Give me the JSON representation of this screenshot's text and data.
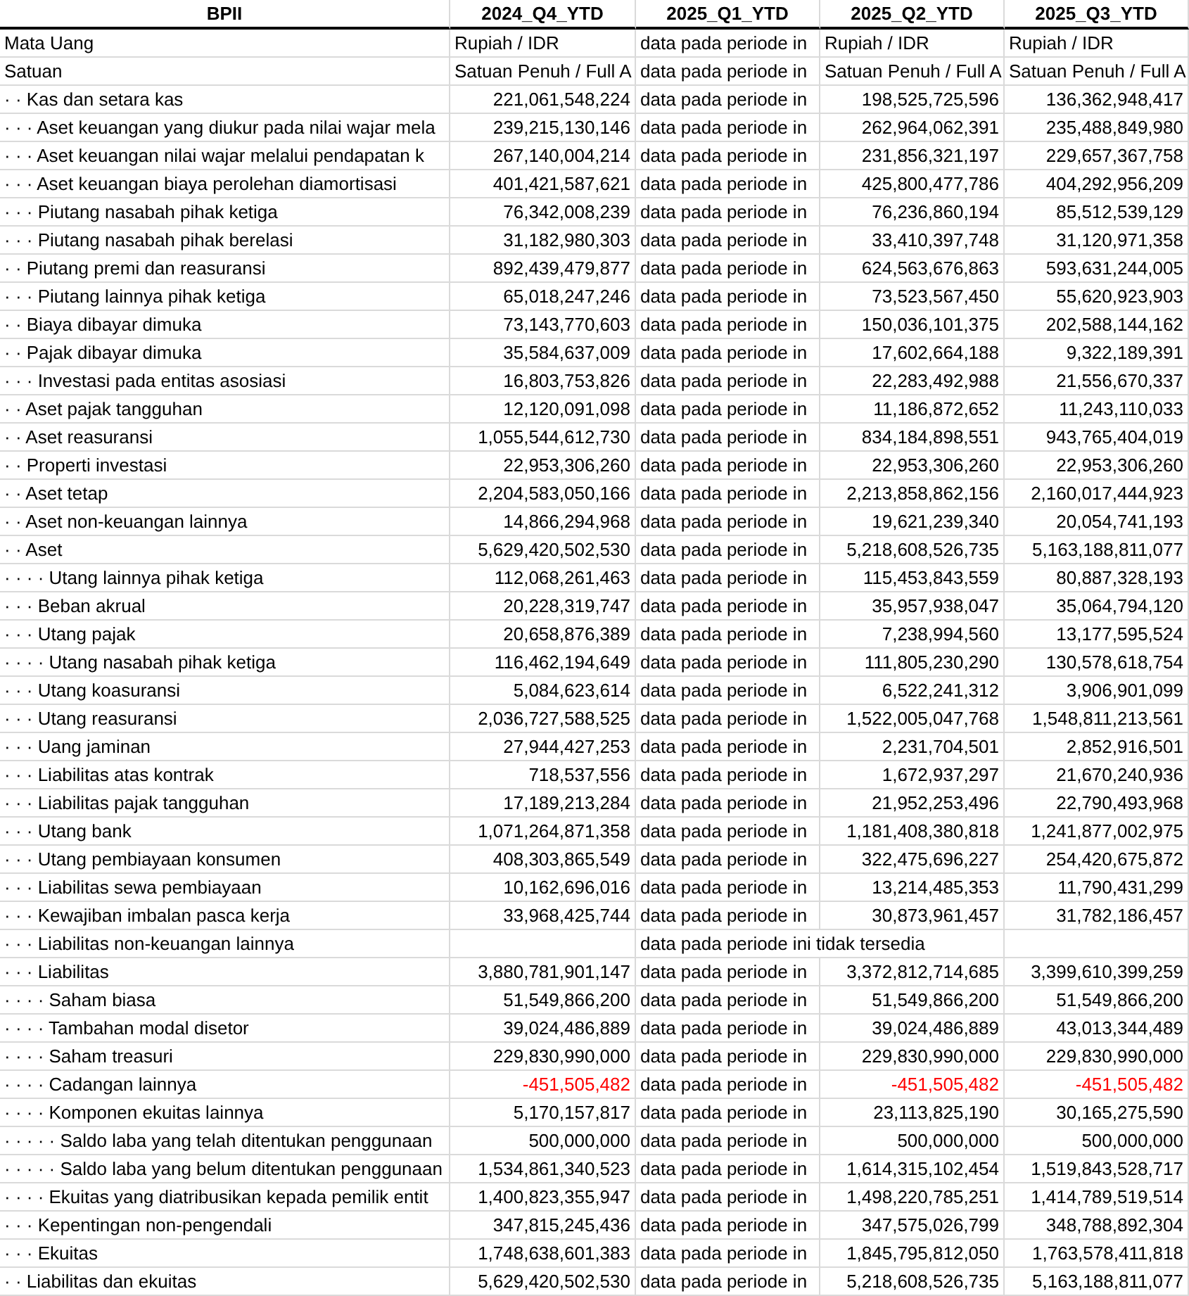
{
  "table": {
    "columns": [
      "BPII",
      "2024_Q4_YTD",
      "2025_Q1_YTD",
      "2025_Q2_YTD",
      "2025_Q3_YTD"
    ],
    "rows": [
      {
        "kind": "meta",
        "label": "Mata Uang",
        "values": [
          "Rupiah / IDR",
          "data pada periode in",
          "Rupiah / IDR",
          "Rupiah / IDR"
        ]
      },
      {
        "kind": "meta",
        "label": "Satuan",
        "values": [
          "Satuan Penuh / Full A",
          "data pada periode in",
          "Satuan Penuh / Full A",
          "Satuan Penuh / Full A"
        ]
      },
      {
        "kind": "data",
        "label": "· · Kas dan setara kas",
        "values": [
          "221,061,548,224",
          "data pada periode in",
          "198,525,725,596",
          "136,362,948,417"
        ]
      },
      {
        "kind": "data",
        "label": "· · · Aset keuangan yang diukur pada nilai wajar mela",
        "values": [
          "239,215,130,146",
          "data pada periode in",
          "262,964,062,391",
          "235,488,849,980"
        ]
      },
      {
        "kind": "data",
        "label": "· · · Aset keuangan nilai wajar melalui pendapatan k",
        "values": [
          "267,140,004,214",
          "data pada periode in",
          "231,856,321,197",
          "229,657,367,758"
        ]
      },
      {
        "kind": "data",
        "label": "· · · Aset keuangan biaya perolehan diamortisasi",
        "values": [
          "401,421,587,621",
          "data pada periode in",
          "425,800,477,786",
          "404,292,956,209"
        ]
      },
      {
        "kind": "data",
        "label": "· · · Piutang nasabah pihak ketiga",
        "values": [
          "76,342,008,239",
          "data pada periode in",
          "76,236,860,194",
          "85,512,539,129"
        ]
      },
      {
        "kind": "data",
        "label": "· · · Piutang nasabah pihak berelasi",
        "values": [
          "31,182,980,303",
          "data pada periode in",
          "33,410,397,748",
          "31,120,971,358"
        ]
      },
      {
        "kind": "data",
        "label": "· · Piutang premi dan reasuransi",
        "values": [
          "892,439,479,877",
          "data pada periode in",
          "624,563,676,863",
          "593,631,244,005"
        ]
      },
      {
        "kind": "data",
        "label": "· · · Piutang lainnya pihak ketiga",
        "values": [
          "65,018,247,246",
          "data pada periode in",
          "73,523,567,450",
          "55,620,923,903"
        ]
      },
      {
        "kind": "data",
        "label": "· · Biaya dibayar dimuka",
        "values": [
          "73,143,770,603",
          "data pada periode in",
          "150,036,101,375",
          "202,588,144,162"
        ]
      },
      {
        "kind": "data",
        "label": "· · Pajak dibayar dimuka",
        "values": [
          "35,584,637,009",
          "data pada periode in",
          "17,602,664,188",
          "9,322,189,391"
        ]
      },
      {
        "kind": "data",
        "label": "· · · Investasi pada entitas asosiasi",
        "values": [
          "16,803,753,826",
          "data pada periode in",
          "22,283,492,988",
          "21,556,670,337"
        ]
      },
      {
        "kind": "data",
        "label": "· · Aset pajak tangguhan",
        "values": [
          "12,120,091,098",
          "data pada periode in",
          "11,186,872,652",
          "11,243,110,033"
        ]
      },
      {
        "kind": "data",
        "label": "· · Aset reasuransi",
        "values": [
          "1,055,544,612,730",
          "data pada periode in",
          "834,184,898,551",
          "943,765,404,019"
        ]
      },
      {
        "kind": "data",
        "label": "· · Properti investasi",
        "values": [
          "22,953,306,260",
          "data pada periode in",
          "22,953,306,260",
          "22,953,306,260"
        ]
      },
      {
        "kind": "data",
        "label": "· · Aset tetap",
        "values": [
          "2,204,583,050,166",
          "data pada periode in",
          "2,213,858,862,156",
          "2,160,017,444,923"
        ]
      },
      {
        "kind": "data",
        "label": "· · Aset non-keuangan lainnya",
        "values": [
          "14,866,294,968",
          "data pada periode in",
          "19,621,239,340",
          "20,054,741,193"
        ]
      },
      {
        "kind": "data",
        "label": "· · Aset",
        "values": [
          "5,629,420,502,530",
          "data pada periode in",
          "5,218,608,526,735",
          "5,163,188,811,077"
        ]
      },
      {
        "kind": "data",
        "label": "· · · · Utang lainnya pihak ketiga",
        "values": [
          "112,068,261,463",
          "data pada periode in",
          "115,453,843,559",
          "80,887,328,193"
        ]
      },
      {
        "kind": "data",
        "label": "· · · Beban akrual",
        "values": [
          "20,228,319,747",
          "data pada periode in",
          "35,957,938,047",
          "35,064,794,120"
        ]
      },
      {
        "kind": "data",
        "label": "· · · Utang pajak",
        "values": [
          "20,658,876,389",
          "data pada periode in",
          "7,238,994,560",
          "13,177,595,524"
        ]
      },
      {
        "kind": "data",
        "label": "· · · · Utang nasabah pihak ketiga",
        "values": [
          "116,462,194,649",
          "data pada periode in",
          "111,805,230,290",
          "130,578,618,754"
        ]
      },
      {
        "kind": "data",
        "label": "· · · Utang koasuransi",
        "values": [
          "5,084,623,614",
          "data pada periode in",
          "6,522,241,312",
          "3,906,901,099"
        ]
      },
      {
        "kind": "data",
        "label": "· · · Utang reasuransi",
        "values": [
          "2,036,727,588,525",
          "data pada periode in",
          "1,522,005,047,768",
          "1,548,811,213,561"
        ]
      },
      {
        "kind": "data",
        "label": "· · · Uang jaminan",
        "values": [
          "27,944,427,253",
          "data pada periode in",
          "2,231,704,501",
          "2,852,916,501"
        ]
      },
      {
        "kind": "data",
        "label": "· · · Liabilitas atas kontrak",
        "values": [
          "718,537,556",
          "data pada periode in",
          "1,672,937,297",
          "21,670,240,936"
        ]
      },
      {
        "kind": "data",
        "label": "· · · Liabilitas pajak tangguhan",
        "values": [
          "17,189,213,284",
          "data pada periode in",
          "21,952,253,496",
          "22,790,493,968"
        ]
      },
      {
        "kind": "data",
        "label": "· · · Utang bank",
        "values": [
          "1,071,264,871,358",
          "data pada periode in",
          "1,181,408,380,818",
          "1,241,877,002,975"
        ]
      },
      {
        "kind": "data",
        "label": "· · · Utang pembiayaan konsumen",
        "values": [
          "408,303,865,549",
          "data pada periode in",
          "322,475,696,227",
          "254,420,675,872"
        ]
      },
      {
        "kind": "data",
        "label": "· · · Liabilitas sewa pembiayaan",
        "values": [
          "10,162,696,016",
          "data pada periode in",
          "13,214,485,353",
          "11,790,431,299"
        ]
      },
      {
        "kind": "data",
        "label": "· · · Kewajiban imbalan pasca kerja",
        "values": [
          "33,968,425,744",
          "data pada periode in",
          "30,873,961,457",
          "31,782,186,457"
        ]
      },
      {
        "kind": "unavailable",
        "label": "· · · Liabilitas non-keuangan lainnya",
        "note": "data pada periode ini tidak tersedia"
      },
      {
        "kind": "data",
        "label": "· · · Liabilitas",
        "values": [
          "3,880,781,901,147",
          "data pada periode in",
          "3,372,812,714,685",
          "3,399,610,399,259"
        ]
      },
      {
        "kind": "data",
        "label": "· · · · Saham biasa",
        "values": [
          "51,549,866,200",
          "data pada periode in",
          "51,549,866,200",
          "51,549,866,200"
        ]
      },
      {
        "kind": "data",
        "label": "· · · · Tambahan modal disetor",
        "values": [
          "39,024,486,889",
          "data pada periode in",
          "39,024,486,889",
          "43,013,344,489"
        ]
      },
      {
        "kind": "data",
        "label": "· · · · Saham treasuri",
        "values": [
          "229,830,990,000",
          "data pada periode in",
          "229,830,990,000",
          "229,830,990,000"
        ]
      },
      {
        "kind": "data",
        "label": "· · · · Cadangan lainnya",
        "values": [
          "-451,505,482",
          "data pada periode in",
          "-451,505,482",
          "-451,505,482"
        ],
        "negative": true
      },
      {
        "kind": "data",
        "label": "· · · · Komponen ekuitas lainnya",
        "values": [
          "5,170,157,817",
          "data pada periode in",
          "23,113,825,190",
          "30,165,275,590"
        ]
      },
      {
        "kind": "data",
        "label": "· · · · · Saldo laba yang telah ditentukan penggunaan",
        "values": [
          "500,000,000",
          "data pada periode in",
          "500,000,000",
          "500,000,000"
        ]
      },
      {
        "kind": "data",
        "label": "· · · · · Saldo laba yang belum ditentukan penggunaan",
        "values": [
          "1,534,861,340,523",
          "data pada periode in",
          "1,614,315,102,454",
          "1,519,843,528,717"
        ]
      },
      {
        "kind": "data",
        "label": "· · · · Ekuitas yang diatribusikan kepada pemilik entit",
        "values": [
          "1,400,823,355,947",
          "data pada periode in",
          "1,498,220,785,251",
          "1,414,789,519,514"
        ]
      },
      {
        "kind": "data",
        "label": "· · · Kepentingan non-pengendali",
        "values": [
          "347,815,245,436",
          "data pada periode in",
          "347,575,026,799",
          "348,788,892,304"
        ]
      },
      {
        "kind": "data",
        "label": "· · · Ekuitas",
        "values": [
          "1,748,638,601,383",
          "data pada periode in",
          "1,845,795,812,050",
          "1,763,578,411,818"
        ]
      },
      {
        "kind": "data",
        "label": "· · Liabilitas dan ekuitas",
        "values": [
          "5,629,420,502,530",
          "data pada periode in",
          "5,218,608,526,735",
          "5,163,188,811,077"
        ]
      }
    ]
  }
}
